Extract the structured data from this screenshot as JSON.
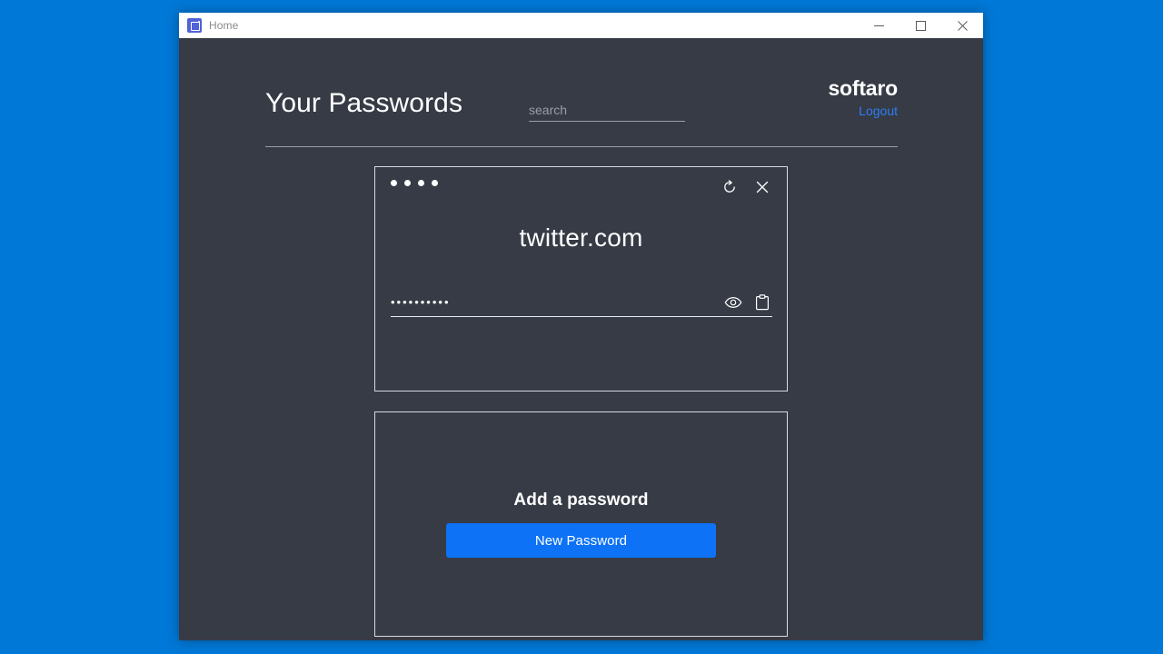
{
  "window": {
    "titlebar": {
      "app_icon": "app-logo-icon",
      "title": "Home",
      "minimize_label": "Minimize",
      "maximize_label": "Maximize",
      "close_label": "Close"
    }
  },
  "header": {
    "page_title": "Your Passwords",
    "search": {
      "placeholder": "search",
      "value": ""
    },
    "brand_name": "softaro",
    "logout_label": "Logout"
  },
  "entry_card": {
    "strength_dots": 4,
    "refresh_icon": "refresh-icon",
    "close_icon": "close-icon",
    "site": "twitter.com",
    "password_masked": "••••••••••",
    "reveal_icon": "eye-icon",
    "copy_icon": "clipboard-icon"
  },
  "add_card": {
    "title": "Add a password",
    "button_label": "New Password"
  },
  "colors": {
    "desktop": "#0078d7",
    "app_background": "#363b45",
    "titlebar": "#ffffff",
    "accent_blue": "#0d72f5",
    "link_blue": "#2f7ef5",
    "card_border": "#d8dadf",
    "muted_text": "#9a9ea6"
  }
}
